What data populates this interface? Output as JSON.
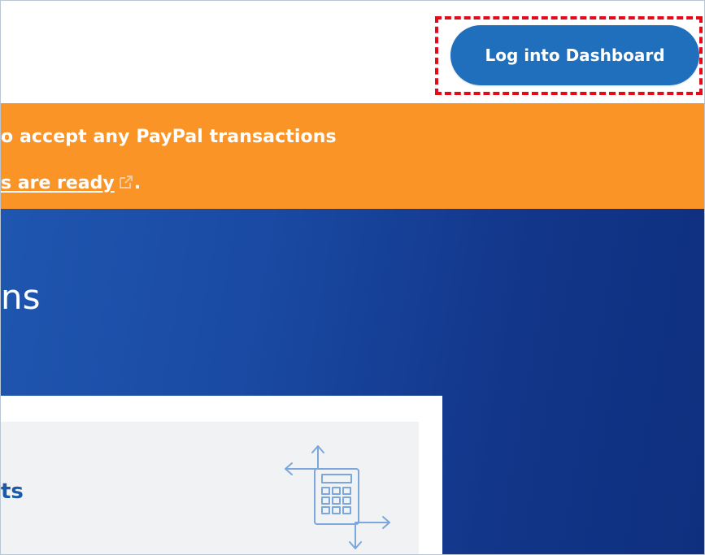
{
  "header": {
    "login_button_label": "Log into Dashboard"
  },
  "banner": {
    "line1": "o accept any PayPal transactions",
    "line2_link": "s are ready",
    "line2_suffix": "."
  },
  "hero": {
    "title": "ns"
  },
  "card": {
    "title": "ts"
  },
  "icons": {
    "external_link": "external-link-icon",
    "calculator": "calculator-arrows-icon"
  },
  "colors": {
    "button": "#1f6fbd",
    "banner": "#fb9426",
    "hero_start": "#1f56b0",
    "hero_end": "#0f2f7e",
    "highlight": "#e50a18",
    "card_title": "#1b5aa6"
  }
}
